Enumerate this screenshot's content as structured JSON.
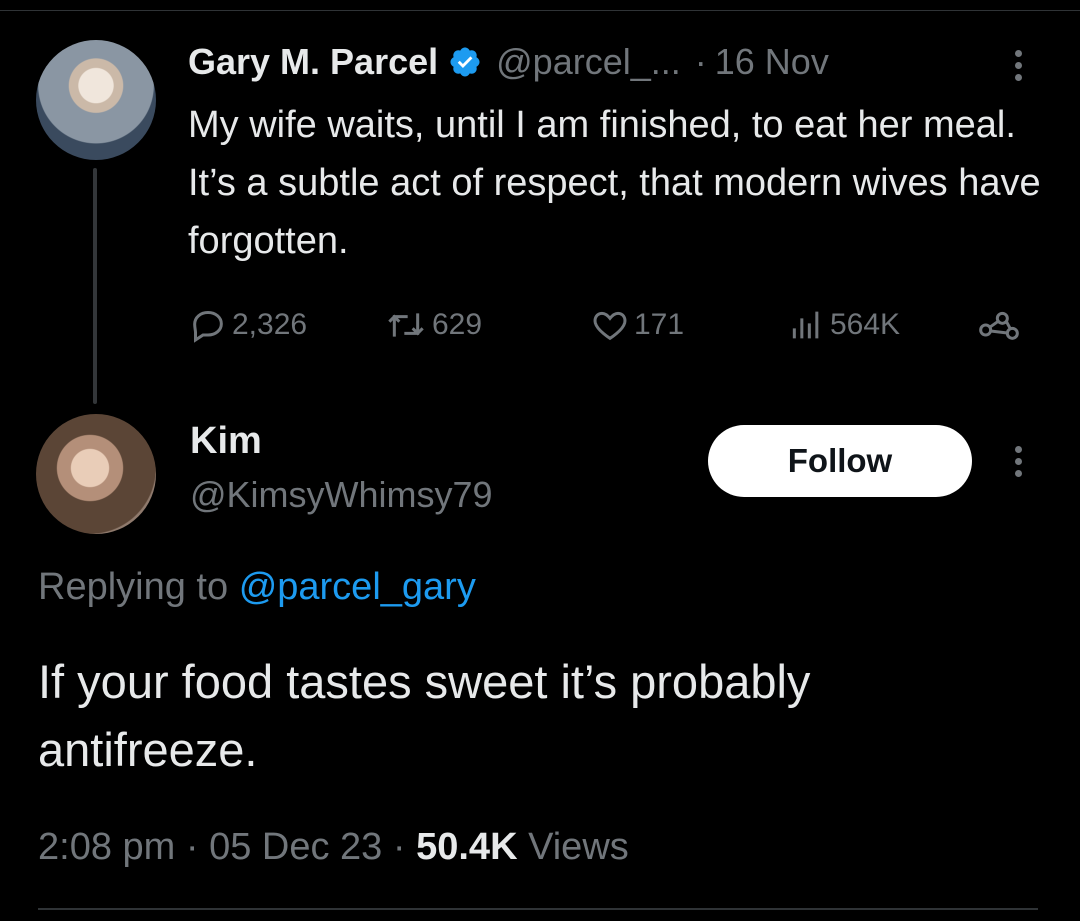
{
  "original": {
    "author_name": "Gary M. Parcel",
    "handle": "@parcel_...",
    "separator": "·",
    "date": "16 Nov",
    "text": "My wife waits, until I am finished, to eat her meal. It’s a subtle act of respect, that modern wives have forgotten.",
    "stats": {
      "replies": "2,326",
      "retweets": "629",
      "likes": "171",
      "views": "564K"
    }
  },
  "reply": {
    "author_name": "Kim",
    "handle": "@KimsyWhimsy79",
    "follow_label": "Follow",
    "replying_prefix": "Replying to",
    "replying_handle": "@parcel_gary",
    "text": "If your food tastes sweet it’s probably antifreeze.",
    "time": "2:08 pm",
    "date": "05 Dec 23",
    "views_count": "50.4K",
    "views_label": "Views"
  },
  "colors": {
    "background": "#000000",
    "primary_text": "#e7e9ea",
    "secondary_text": "#71767b",
    "link": "#1d9bf0",
    "verified": "#1d9bf0"
  }
}
